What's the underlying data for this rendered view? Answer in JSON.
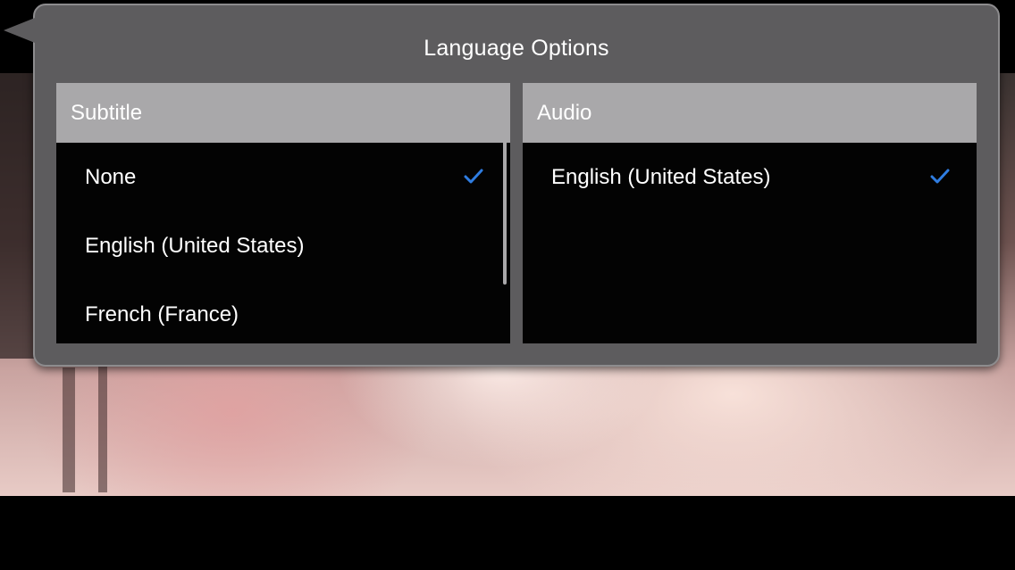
{
  "popover": {
    "title": "Language Options"
  },
  "subtitle_panel": {
    "header": "Subtitle",
    "items": [
      {
        "label": "None",
        "selected": true
      },
      {
        "label": "English (United States)",
        "selected": false
      },
      {
        "label": "French (France)",
        "selected": false
      }
    ]
  },
  "audio_panel": {
    "header": "Audio",
    "items": [
      {
        "label": "English (United States)",
        "selected": true
      }
    ]
  },
  "colors": {
    "accent_check": "#2f7de1",
    "popover_bg": "#5d5c5e",
    "header_bg": "#a9a8aa",
    "list_bg": "#030303"
  },
  "icons": {
    "selected": "checkmark-icon"
  }
}
